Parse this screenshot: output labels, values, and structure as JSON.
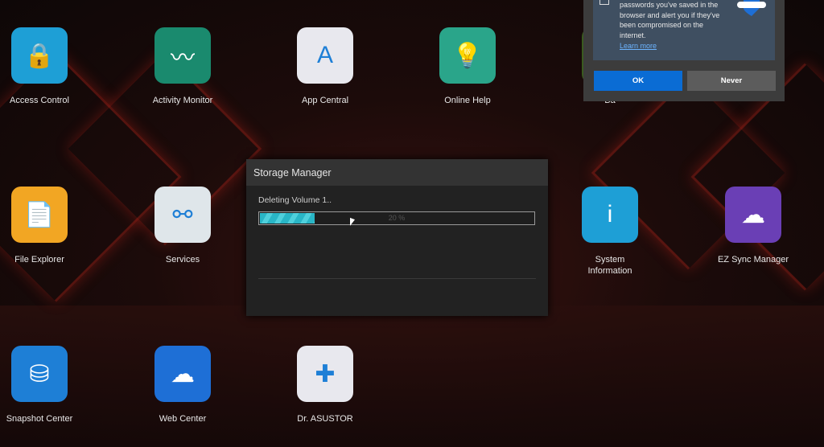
{
  "desktop": {
    "apps": [
      {
        "label": "Access Control",
        "icon": "id-badge-lock-icon",
        "color": "#1e9fd6"
      },
      {
        "label": "Activity Monitor",
        "icon": "heartbeat-monitor-icon",
        "color": "#1a8a6e"
      },
      {
        "label": "App Central",
        "icon": "app-central-rainbow-icon",
        "color": "#e8e8ee"
      },
      {
        "label": "Online Help",
        "icon": "help-map-icon",
        "color": "#2aa58a"
      },
      {
        "label": "Ba",
        "icon": "backup-icon",
        "color": "#3a5a20"
      },
      {
        "label": "File Explorer",
        "icon": "folder-icon",
        "color": "#f2a623"
      },
      {
        "label": "Services",
        "icon": "services-nodes-icon",
        "color": "#dfe6ea"
      },
      {
        "label": "System Information",
        "icon": "info-icon",
        "color": "#1e9fd6"
      },
      {
        "label": "EZ Sync Manager",
        "icon": "cloud-sync-icon",
        "color": "#6a3fb5"
      },
      {
        "label": "Snapshot Center",
        "icon": "database-camera-icon",
        "color": "#1e7fd6"
      },
      {
        "label": "Web Center",
        "icon": "cloud-server-icon",
        "color": "#1e6fd6"
      },
      {
        "label": "Dr. ASUSTOR",
        "icon": "nas-health-icon",
        "color": "#e8e8ee"
      }
    ]
  },
  "dialog": {
    "title": "Storage Manager",
    "message": "Deleting Volume 1..",
    "progress_percent": 20,
    "progress_label": "20 %",
    "progress_color": "#29b6c6"
  },
  "password_popup": {
    "text": "passwords you've saved in the browser and alert you if they've been compromised on the internet.",
    "learn_more": "Learn more",
    "ok": "OK",
    "never": "Never",
    "ok_color": "#0a6cd4"
  }
}
